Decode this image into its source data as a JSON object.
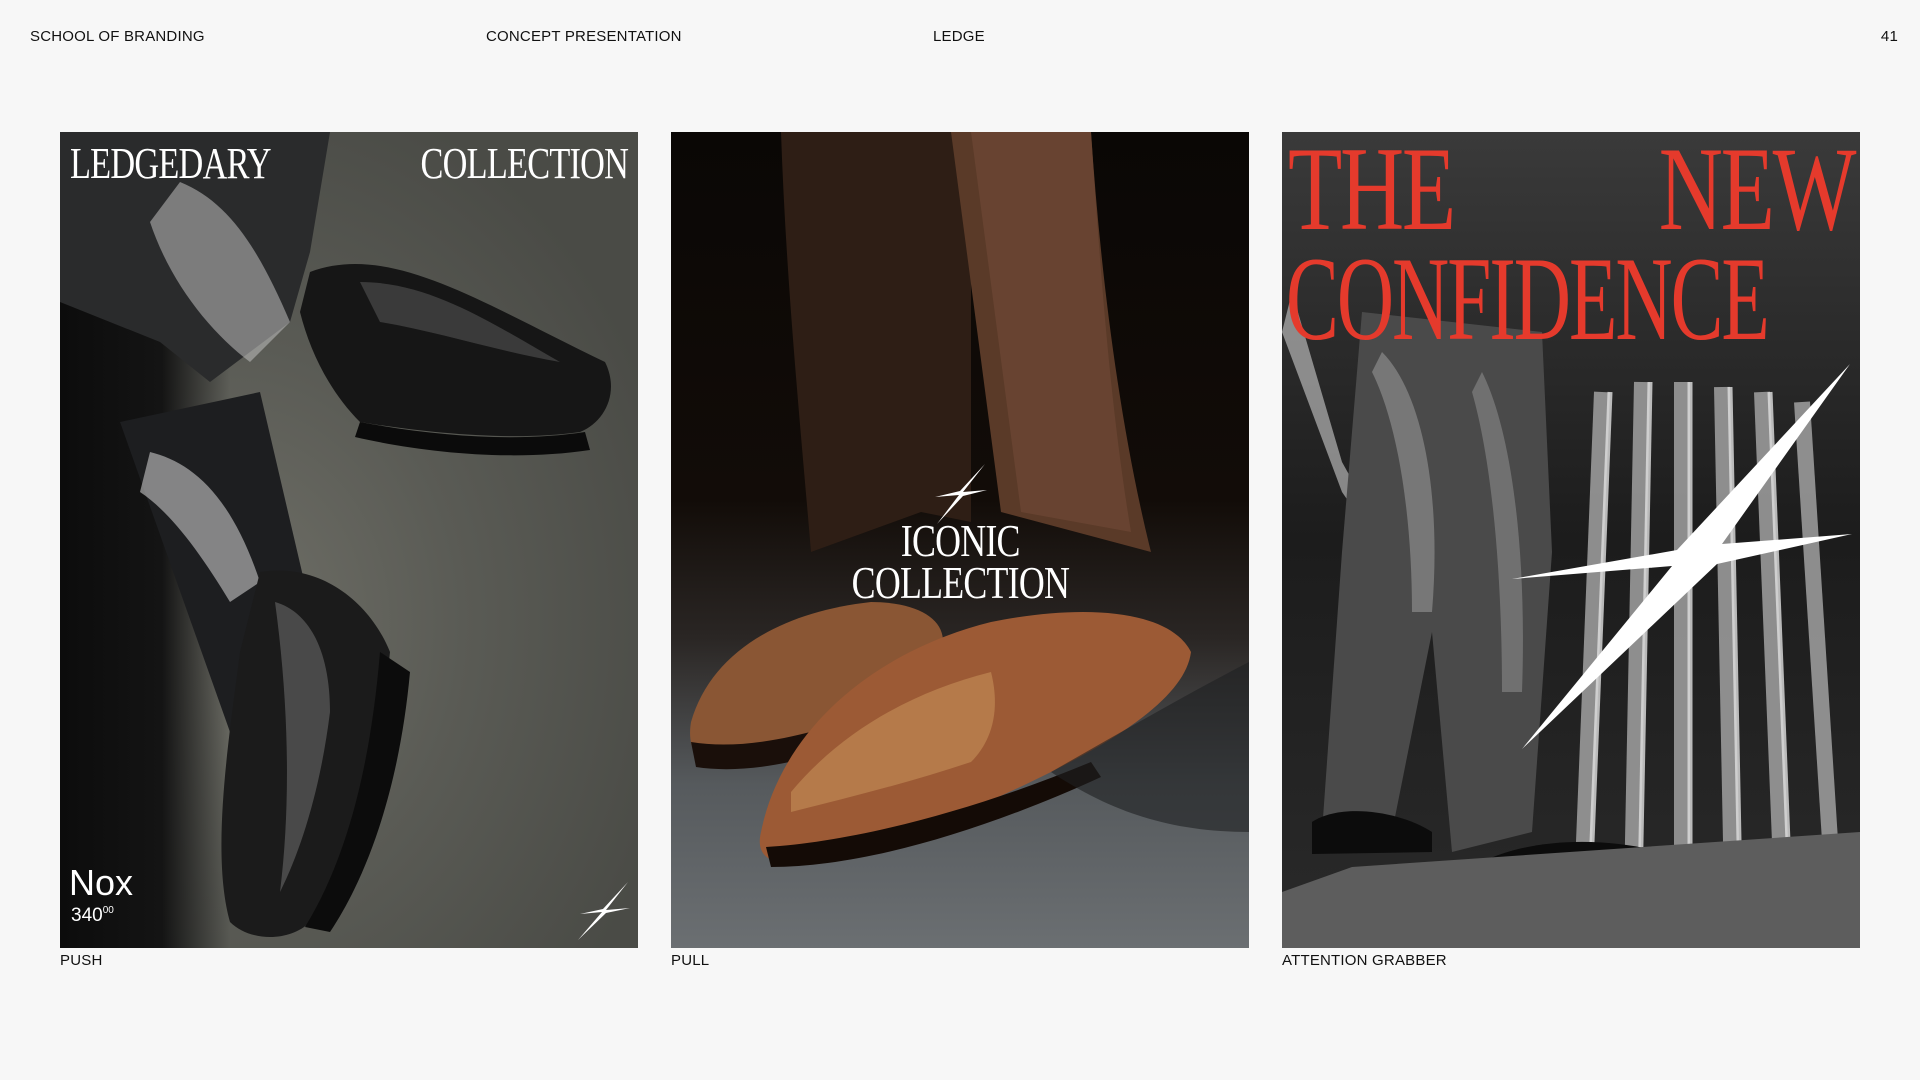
{
  "header": {
    "school": "SCHOOL OF BRANDING",
    "section": "CONCEPT PRESENTATION",
    "brand": "LEDGE",
    "page_number": "41"
  },
  "posters": [
    {
      "caption": "PUSH",
      "title_left": "LEDGEDARY",
      "title_right": "COLLECTION",
      "product_name": "Nox",
      "price_main": "340",
      "price_cents": "00",
      "logo_icon": "ledge-star-icon"
    },
    {
      "caption": "PULL",
      "line1": "ICONIC",
      "line2": "COLLECTION",
      "logo_icon": "ledge-star-icon"
    },
    {
      "caption": "ATTENTION GRABBER",
      "word1": "THE",
      "word2": "NEW",
      "word3": "CONFIDENCE",
      "headline_color": "#e53a2c",
      "logo_icon": "ledge-star-icon"
    }
  ]
}
